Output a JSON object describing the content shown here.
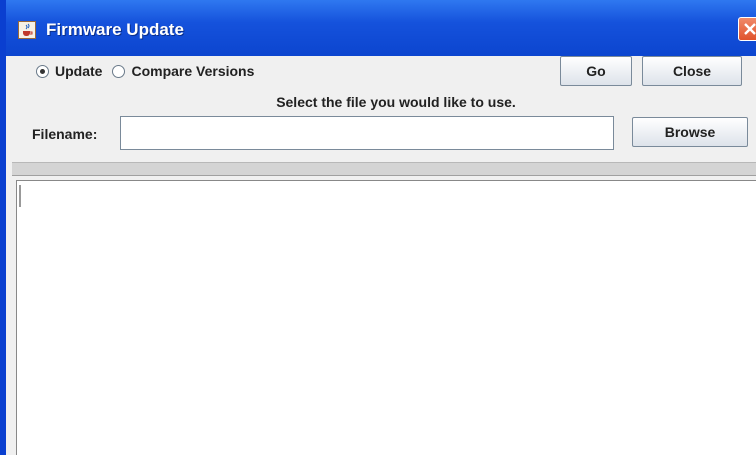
{
  "window": {
    "title": "Firmware Update",
    "title_icon": "java-cup-icon",
    "close_icon": "close-icon"
  },
  "mode": {
    "options": [
      {
        "label": "Update",
        "selected": true
      },
      {
        "label": "Compare Versions",
        "selected": false
      }
    ]
  },
  "toolbar": {
    "go_label": "Go",
    "close_label": "Close",
    "browse_label": "Browse"
  },
  "form": {
    "instruction": "Select the file you would like to use.",
    "filename_label": "Filename:",
    "filename_value": "",
    "filename_placeholder": ""
  },
  "output": {
    "text": ""
  },
  "colors": {
    "titlebar": "#1552dc",
    "panel_bg": "#f0f0f0",
    "close_button": "#e0532c"
  }
}
